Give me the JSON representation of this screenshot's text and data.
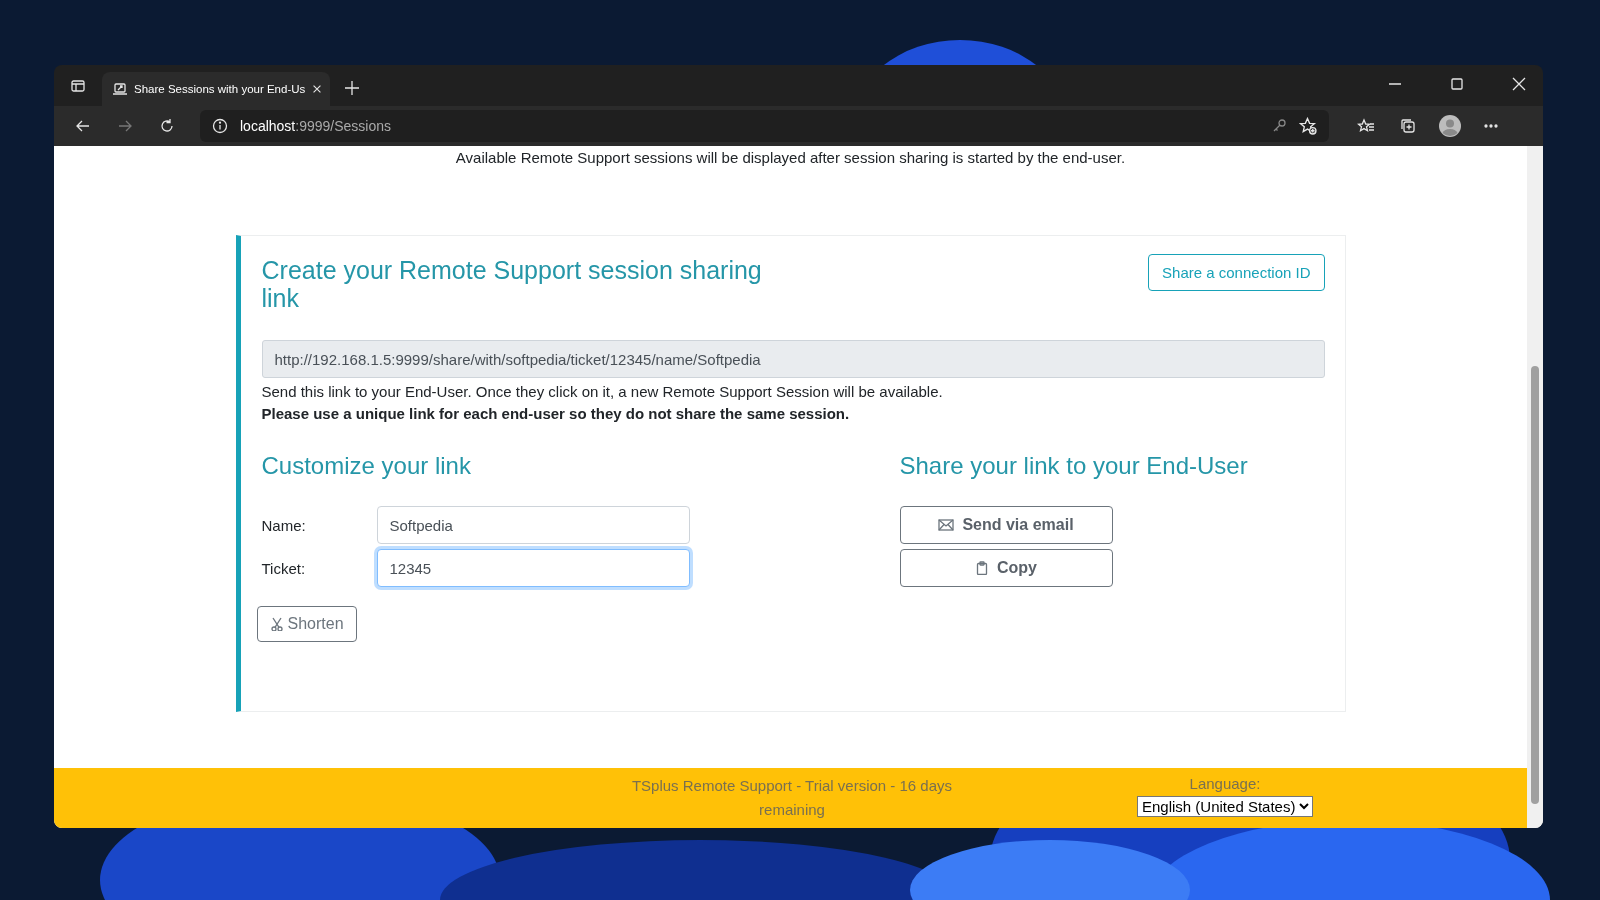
{
  "browser": {
    "tab_title": "Share Sessions with your End-Us",
    "address": {
      "host": "localhost",
      "path": ":9999/Sessions"
    }
  },
  "notice": "Available Remote Support sessions will be displayed after session sharing is started by the end-user.",
  "card": {
    "title": "Create your Remote Support session sharing link",
    "action_button": "Share a connection ID",
    "link_value": "http://192.168.1.5:9999/share/with/softpedia/ticket/12345/name/Softpedia",
    "help": "Send this link to your End-User. Once they click on it, a new Remote Support Session will be available.",
    "warning": "Please use a unique link for each end-user so they do not share the same session.",
    "customize": {
      "title": "Customize your link",
      "fields": [
        {
          "label": "Name:",
          "value": "Softpedia",
          "focused": false
        },
        {
          "label": "Ticket:",
          "value": "12345",
          "focused": true
        }
      ],
      "button": "Shorten"
    },
    "share": {
      "title": "Share your link to your End-User",
      "buttons": [
        {
          "kind": "email",
          "label": "Send via email"
        },
        {
          "kind": "copy",
          "label": "Copy"
        }
      ]
    }
  },
  "footer": {
    "text": "TSplus Remote Support - Trial version - 16 days remaining",
    "language_label": "Language:",
    "language_value": "English (United States)"
  }
}
